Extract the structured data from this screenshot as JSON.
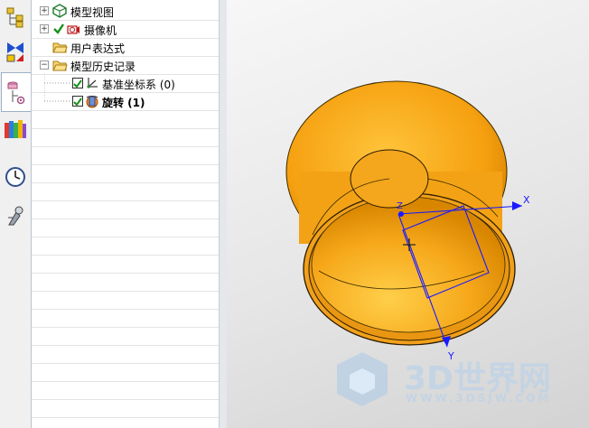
{
  "tree": {
    "items": [
      {
        "label": "模型视图"
      },
      {
        "label": "摄像机"
      },
      {
        "label": "用户表达式"
      },
      {
        "label": "模型历史记录"
      },
      {
        "label": "基准坐标系 (0)"
      },
      {
        "label": "旋转 (1)"
      }
    ]
  },
  "viewport": {
    "axes": {
      "x": "X",
      "y": "Y",
      "z": "Z"
    }
  },
  "watermark": {
    "brand": "3D世界网",
    "url": "WWW.3DSJW.COM"
  },
  "colors": {
    "part": "#f5a623",
    "axis": "#1a1aff",
    "check": "#1a8f1a"
  },
  "icons": [
    "assemblies-icon",
    "constraint-icon",
    "part-navigator-icon",
    "reuse-library-icon",
    "history-icon",
    "system-material-icon"
  ]
}
